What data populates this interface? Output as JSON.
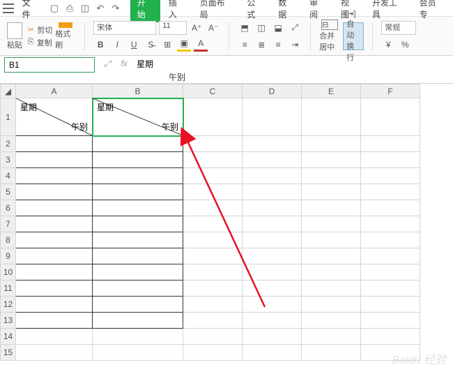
{
  "menubar": {
    "file_label": "文件",
    "tabs": [
      "开始",
      "插入",
      "页面布局",
      "公式",
      "数据",
      "审阅",
      "视图",
      "开发工具",
      "会员专"
    ]
  },
  "ribbon": {
    "paste_label": "粘贴",
    "cut_label": "剪切",
    "copy_label": "复制",
    "format_painter_label": "格式刷",
    "font_name": "宋体",
    "font_size": "11",
    "merge_label": "合并居中",
    "wrap_label": "自动换行",
    "general_label": "常规",
    "currency_prefix": "¥",
    "percent_label": "%"
  },
  "formula_bar": {
    "name_box": "B1",
    "fx_label": "fx",
    "value_line1": "星期",
    "value_line2": "午别"
  },
  "columns": [
    "A",
    "B",
    "C",
    "D",
    "E",
    "F"
  ],
  "rows": [
    "1",
    "2",
    "3",
    "4",
    "5",
    "6",
    "7",
    "8",
    "9",
    "10",
    "11",
    "12",
    "13",
    "14",
    "15"
  ],
  "cells": {
    "A1": {
      "top": "星期",
      "bottom": "午别"
    },
    "B1": {
      "top": "星期",
      "bottom": "午别"
    }
  },
  "watermark": "Baidu 经验"
}
